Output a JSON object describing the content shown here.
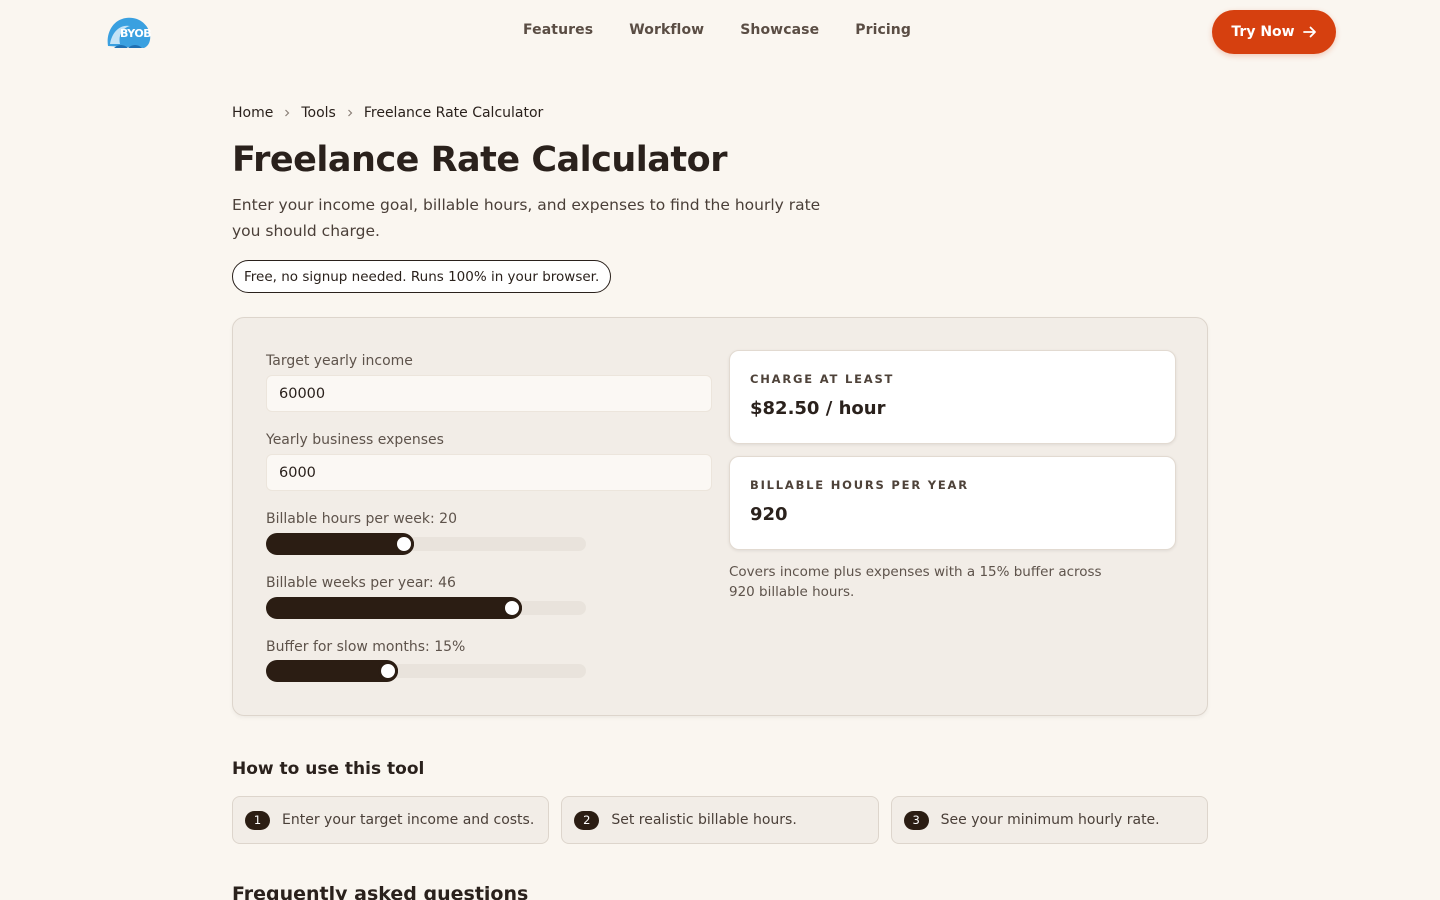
{
  "header": {
    "logo_text": "BYOB",
    "nav": [
      {
        "label": "Features"
      },
      {
        "label": "Workflow"
      },
      {
        "label": "Showcase"
      },
      {
        "label": "Pricing"
      }
    ],
    "cta_label": "Try Now"
  },
  "breadcrumb": [
    "Home",
    "Tools",
    "Freelance Rate Calculator"
  ],
  "page": {
    "title": "Freelance Rate Calculator",
    "subtitle": "Enter your income goal, billable hours, and expenses to find the hourly rate you should charge.",
    "badge": "Free, no signup needed. Runs 100% in your browser."
  },
  "calculator": {
    "income_label": "Target yearly income",
    "income_value": "60000",
    "expenses_label": "Yearly business expenses",
    "expenses_value": "6000",
    "sliders": [
      {
        "label": "Billable hours per week: 20",
        "fraction": 0.43
      },
      {
        "label": "Billable weeks per year: 46",
        "fraction": 0.77
      },
      {
        "label": "Buffer for slow months: 15%",
        "fraction": 0.38
      }
    ],
    "results": [
      {
        "label": "CHARGE AT LEAST",
        "value": "$82.50 / hour"
      },
      {
        "label": "BILLABLE HOURS PER YEAR",
        "value": "920"
      }
    ],
    "note": "Covers income plus expenses with a 15% buffer across 920 billable hours."
  },
  "howto": {
    "title": "How to use this tool",
    "steps": [
      {
        "num": "1",
        "text": "Enter your target income and costs."
      },
      {
        "num": "2",
        "text": "Set realistic billable hours."
      },
      {
        "num": "3",
        "text": "See your minimum hourly rate."
      }
    ]
  },
  "faq": {
    "title": "Frequently asked questions"
  },
  "colors": {
    "accent": "#d6400f",
    "dark": "#2b1d13",
    "background": "#faf6f0"
  }
}
